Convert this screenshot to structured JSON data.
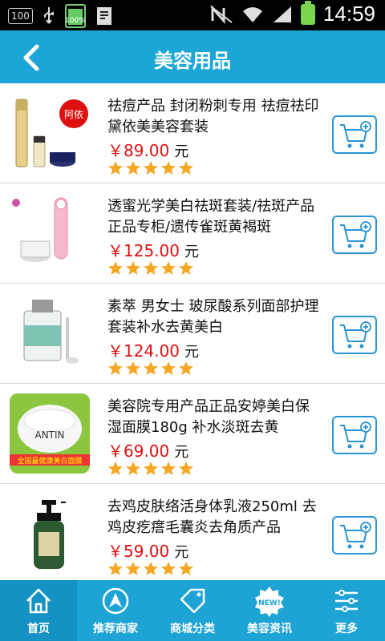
{
  "status_bar": {
    "left_box": "100",
    "battery_small": "100%",
    "time": "14:59"
  },
  "app_bar": {
    "title": "美容用品",
    "back_icon": "chevron-left-icon"
  },
  "products": [
    {
      "name": "祛痘产品 封闭粉刺专用 祛痘祛印 黛依美美容套装",
      "price": "￥89.00",
      "unit": "元",
      "rating": 5
    },
    {
      "name": "透蜜光学美白祛斑套装/祛斑产品正品专柜/遗传雀斑黄褐斑",
      "price": "￥125.00",
      "unit": "元",
      "rating": 5
    },
    {
      "name": "素萃 男女士 玻尿酸系列面部护理套装补水去黄美白",
      "price": "￥124.00",
      "unit": "元",
      "rating": 5
    },
    {
      "name": "美容院专用产品正品安婷美白保湿面膜180g 补水淡斑去黄",
      "price": "￥69.00",
      "unit": "元",
      "rating": 5
    },
    {
      "name": "去鸡皮肤络活身体乳液250ml 去鸡皮疙瘩毛囊炎去角质产品",
      "price": "￥59.00",
      "unit": "元",
      "rating": 5
    }
  ],
  "thumb_text": {
    "p1_brand": "阿依",
    "p4_brand": "ANTIN",
    "p4_banner": "全国最健康美白面膜"
  },
  "tabs": [
    {
      "label": "首页",
      "icon": "home-icon",
      "active": true
    },
    {
      "label": "推荐商家",
      "icon": "navigation-arrow-icon",
      "active": false
    },
    {
      "label": "商城分类",
      "icon": "sale-tag-icon",
      "active": false
    },
    {
      "label": "美容资讯",
      "icon": "new-badge-icon",
      "active": false,
      "badge": "NEW!"
    },
    {
      "label": "更多",
      "icon": "sliders-icon",
      "active": false
    }
  ],
  "colors": {
    "app_bar": "#1ca6d6",
    "tab_bar": "#1da3d4",
    "price": "#e01010",
    "star": "#f5a623",
    "cart_border": "#2a93d5"
  }
}
